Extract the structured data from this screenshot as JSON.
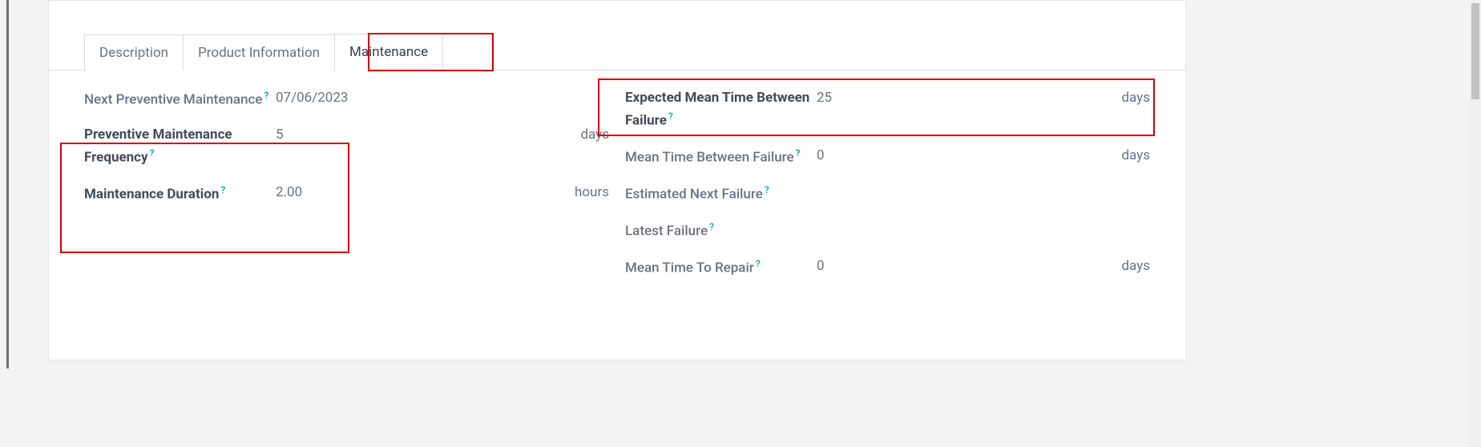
{
  "tabs": {
    "description": "Description",
    "product_info": "Product Information",
    "maintenance": "Maintenance"
  },
  "left": {
    "next_pm_label": "Next Preventive Maintenance",
    "next_pm_value": "07/06/2023",
    "pm_freq_label": "Preventive Maintenance Frequency",
    "pm_freq_value": "5",
    "pm_freq_unit": "days",
    "maint_dur_label": "Maintenance Duration",
    "maint_dur_value": "2.00",
    "maint_dur_unit": "hours"
  },
  "right": {
    "emtbf_label": "Expected Mean Time Between Failure",
    "emtbf_value": "25",
    "emtbf_unit": "days",
    "mtbf_label": "Mean Time Between Failure",
    "mtbf_value": "0",
    "mtbf_unit": "days",
    "enf_label": "Estimated Next Failure",
    "lf_label": "Latest Failure",
    "mttr_label": "Mean Time To Repair",
    "mttr_value": "0",
    "mttr_unit": "days"
  },
  "help_glyph": "?"
}
